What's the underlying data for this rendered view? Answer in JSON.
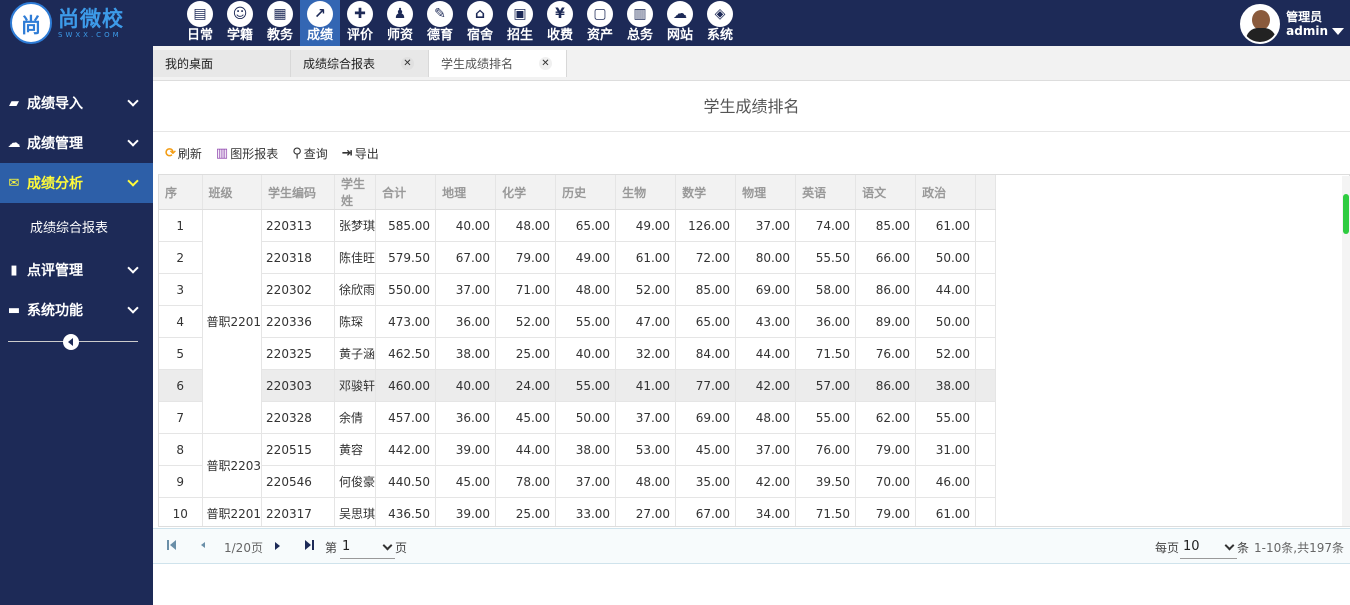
{
  "brand": {
    "logo_mark": "尚",
    "name": "尚微校",
    "sub": "SWXX.COM"
  },
  "nav": [
    {
      "label": "日常",
      "icon": "document-icon",
      "glyph": "▤",
      "active": false
    },
    {
      "label": "学籍",
      "icon": "person-icon",
      "glyph": "☺",
      "active": false
    },
    {
      "label": "教务",
      "icon": "calendar-icon",
      "glyph": "▦",
      "active": false
    },
    {
      "label": "成绩",
      "icon": "trend-chart-icon",
      "glyph": "↗",
      "active": true
    },
    {
      "label": "评价",
      "icon": "calendar-plus-icon",
      "glyph": "✚",
      "active": false
    },
    {
      "label": "师资",
      "icon": "teacher-icon",
      "glyph": "♟",
      "active": false
    },
    {
      "label": "德育",
      "icon": "book-icon",
      "glyph": "✎",
      "active": false
    },
    {
      "label": "宿舍",
      "icon": "home-icon",
      "glyph": "⌂",
      "active": false
    },
    {
      "label": "招生",
      "icon": "bus-icon",
      "glyph": "▣",
      "active": false
    },
    {
      "label": "收费",
      "icon": "yen-icon",
      "glyph": "¥",
      "active": false
    },
    {
      "label": "资产",
      "icon": "train-icon",
      "glyph": "▢",
      "active": false
    },
    {
      "label": "总务",
      "icon": "bar-chart-icon",
      "glyph": "▥",
      "active": false
    },
    {
      "label": "网站",
      "icon": "cloud-icon",
      "glyph": "☁",
      "active": false
    },
    {
      "label": "系统",
      "icon": "cube-icon",
      "glyph": "◈",
      "active": false
    }
  ],
  "user": {
    "role": "管理员",
    "name": "admin"
  },
  "sidebar": {
    "items": [
      {
        "label": "成绩导入",
        "icon": "book-icon",
        "glyph": "▰"
      },
      {
        "label": "成绩管理",
        "icon": "cloud-icon",
        "glyph": "☁"
      },
      {
        "label": "成绩分析",
        "icon": "envelope-icon",
        "glyph": "✉"
      },
      {
        "label": "点评管理",
        "icon": "file-icon",
        "glyph": "▮"
      },
      {
        "label": "系统功能",
        "icon": "folder-icon",
        "glyph": "▬"
      }
    ],
    "sub_item": "成绩综合报表"
  },
  "tabs": [
    {
      "label": "我的桌面"
    },
    {
      "label": "成绩综合报表"
    },
    {
      "label": "学生成绩排名"
    }
  ],
  "page": {
    "title": "学生成绩排名"
  },
  "toolbar": {
    "refresh": "刷新",
    "chart_report": "图形报表",
    "query": "查询",
    "export": "导出"
  },
  "table": {
    "headers": [
      "序",
      "班级",
      "学生编码",
      "学生姓",
      "合计",
      "地理",
      "化学",
      "历史",
      "生物",
      "数学",
      "物理",
      "英语",
      "语文",
      "政治"
    ],
    "class_groups": [
      {
        "label": "普职2201",
        "rows": 7
      },
      {
        "label": "普职2203",
        "rows": 2
      },
      {
        "label": "普职2201",
        "rows": 1
      }
    ],
    "highlighted_row": 6,
    "rows": [
      [
        "1",
        "220313",
        "张梦琪",
        "585.00",
        "40.00",
        "48.00",
        "65.00",
        "49.00",
        "126.00",
        "37.00",
        "74.00",
        "85.00",
        "61.00"
      ],
      [
        "2",
        "220318",
        "陈佳旺",
        "579.50",
        "67.00",
        "79.00",
        "49.00",
        "61.00",
        "72.00",
        "80.00",
        "55.50",
        "66.00",
        "50.00"
      ],
      [
        "3",
        "220302",
        "徐欣雨",
        "550.00",
        "37.00",
        "71.00",
        "48.00",
        "52.00",
        "85.00",
        "69.00",
        "58.00",
        "86.00",
        "44.00"
      ],
      [
        "4",
        "220336",
        "陈琛",
        "473.00",
        "36.00",
        "52.00",
        "55.00",
        "47.00",
        "65.00",
        "43.00",
        "36.00",
        "89.00",
        "50.00"
      ],
      [
        "5",
        "220325",
        "黄子涵",
        "462.50",
        "38.00",
        "25.00",
        "40.00",
        "32.00",
        "84.00",
        "44.00",
        "71.50",
        "76.00",
        "52.00"
      ],
      [
        "6",
        "220303",
        "邓骏轩",
        "460.00",
        "40.00",
        "24.00",
        "55.00",
        "41.00",
        "77.00",
        "42.00",
        "57.00",
        "86.00",
        "38.00"
      ],
      [
        "7",
        "220328",
        "余倩",
        "457.00",
        "36.00",
        "45.00",
        "50.00",
        "37.00",
        "69.00",
        "48.00",
        "55.00",
        "62.00",
        "55.00"
      ],
      [
        "8",
        "220515",
        "黄容",
        "442.00",
        "39.00",
        "44.00",
        "38.00",
        "53.00",
        "45.00",
        "37.00",
        "76.00",
        "79.00",
        "31.00"
      ],
      [
        "9",
        "220546",
        "何俊豪",
        "440.50",
        "45.00",
        "78.00",
        "37.00",
        "48.00",
        "35.00",
        "42.00",
        "39.50",
        "70.00",
        "46.00"
      ],
      [
        "10",
        "220317",
        "吴思琪",
        "436.50",
        "39.00",
        "25.00",
        "33.00",
        "27.00",
        "67.00",
        "34.00",
        "71.50",
        "79.00",
        "61.00"
      ]
    ]
  },
  "pager": {
    "page_info": "1/20页",
    "goto_prefix": "第",
    "current_page": "1",
    "goto_suffix": "页",
    "per_page_prefix": "每页",
    "per_page": "10",
    "per_page_suffix": "条",
    "total": "1-10条,共197条"
  },
  "colors": {
    "topbar": "#1d2a57",
    "nav_active": "#3366b3",
    "sidebar_active": "#2d5fa8",
    "sidebar_active_text": "#fffb3a",
    "scroll_thumb": "#2ecc40",
    "toolbar_refresh": "#f39c12",
    "toolbar_chart": "#8e44ad"
  }
}
